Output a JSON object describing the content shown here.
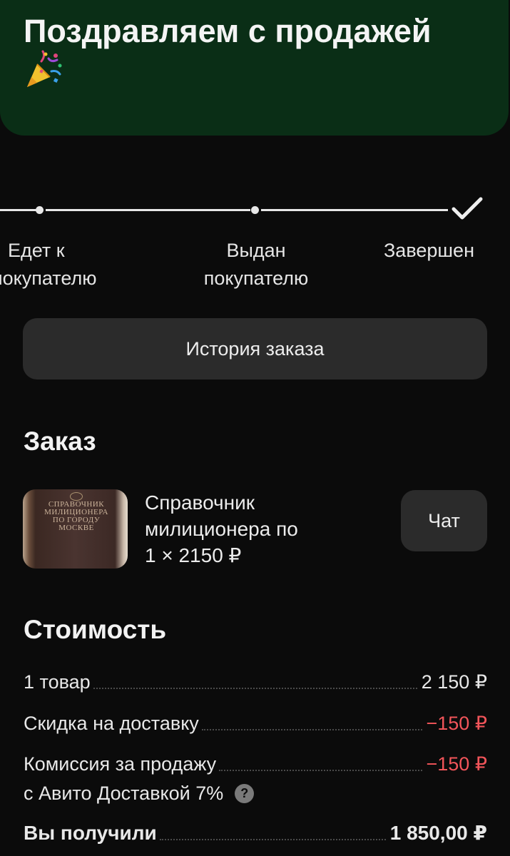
{
  "header": {
    "title": "Поздравляем с продажей",
    "icon": "party-popper-icon",
    "background": "#0a2e16"
  },
  "tracker": {
    "steps": [
      {
        "line1": "Едет к",
        "line2": "покупателю"
      },
      {
        "line1": "Выдан",
        "line2": "покупателю"
      },
      {
        "line1": "Завершен",
        "line2": ""
      }
    ],
    "current_step": 3
  },
  "history_button": {
    "label": "История заказа"
  },
  "order": {
    "section_title": "Заказ",
    "item": {
      "title_line1": "Справочник",
      "title_line2": "милиционера по",
      "price_line": "1 × 2150 ₽",
      "image_text": "СПРАВОЧНИК МИЛИЦИОНЕРА ПО ГОРОДУ МОСКВЕ"
    },
    "chat_button": {
      "label": "Чат"
    }
  },
  "cost": {
    "section_title": "Стоимость",
    "rows": [
      {
        "label": "1 товар",
        "value": "2 150 ₽"
      },
      {
        "label": "Скидка на доставку",
        "value": "−150 ₽"
      },
      {
        "label": "Комиссия за продажу",
        "label_line2": "с Авито Доставкой 7%",
        "value": "−150 ₽"
      }
    ],
    "total": {
      "label": "Вы получили",
      "value": "1 850,00 ₽"
    },
    "negative_color": "#f2555a"
  }
}
